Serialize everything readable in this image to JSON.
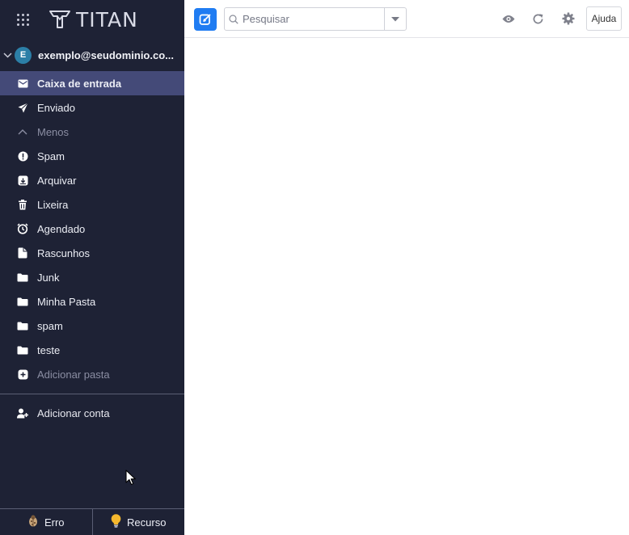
{
  "brand": {
    "logo_text": "TITAN"
  },
  "account": {
    "initial": "E",
    "email": "exemplo@seudominio.co..."
  },
  "folders": [
    {
      "label": "Caixa de entrada",
      "icon": "inbox-envelope-icon",
      "active": true
    },
    {
      "label": "Enviado",
      "icon": "send-icon"
    },
    {
      "label": "Menos",
      "icon": "chevron-up-icon",
      "muted": true
    },
    {
      "label": "Spam",
      "icon": "exclamation-icon"
    },
    {
      "label": "Arquivar",
      "icon": "archive-icon"
    },
    {
      "label": "Lixeira",
      "icon": "trash-icon"
    },
    {
      "label": "Agendado",
      "icon": "alarm-clock-icon"
    },
    {
      "label": "Rascunhos",
      "icon": "draft-icon"
    },
    {
      "label": "Junk",
      "icon": "folder-icon"
    },
    {
      "label": "Minha Pasta",
      "icon": "folder-icon"
    },
    {
      "label": "spam",
      "icon": "folder-icon"
    },
    {
      "label": "teste",
      "icon": "folder-icon"
    },
    {
      "label": "Adicionar pasta",
      "icon": "plus-square-icon",
      "muted": true
    }
  ],
  "add_account": {
    "label": "Adicionar conta",
    "icon": "add-user-icon"
  },
  "bottom": {
    "bug_label": "Erro",
    "feature_label": "Recurso"
  },
  "topbar": {
    "search_placeholder": "Pesquisar",
    "help_label": "Ajuda"
  },
  "colors": {
    "sidebar_bg": "#1e2235",
    "active_item": "#444a78",
    "accent": "#1f7cf2",
    "avatar": "#2c7fa7"
  }
}
